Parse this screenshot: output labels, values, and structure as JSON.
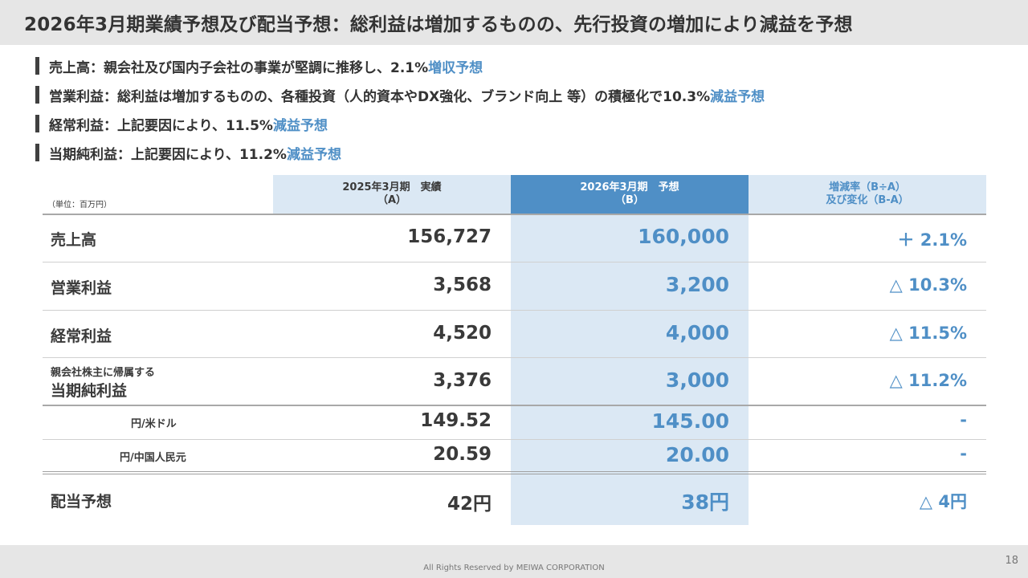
{
  "slide_title": "2026年3月期業績予想及び配当予想：総利益は増加するものの、先行投資の増加により減益を予想",
  "bullets": [
    {
      "text": "売上高：親会社及び国内子会社の事業が堅調に推移し、2.1%",
      "highlight": "増収予想"
    },
    {
      "text": "営業利益：総利益は増加するものの、各種投資（人的資本やDX強化、ブランド向上 等）の積極化で10.3%",
      "highlight": "減益予想"
    },
    {
      "text": "経常利益：上記要因により、11.5%",
      "highlight": "減益予想"
    },
    {
      "text": "当期純利益：上記要因により、11.2%",
      "highlight": "減益予想"
    }
  ],
  "table": {
    "unit": "（単位：百万円）",
    "headers": {
      "a_line1": "2025年3月期　実績",
      "a_line2": "（A）",
      "b_line1": "2026年3月期　予想",
      "b_line2": "（B）",
      "c_line1": "増減率（B÷A）",
      "c_line2": "及び変化（B-A）"
    },
    "rows": [
      {
        "label": "売上高",
        "a": "156,727",
        "b": "160,000",
        "c": "＋ 2.1%"
      },
      {
        "label": "営業利益",
        "a": "3,568",
        "b": "3,200",
        "c": "△ 10.3%"
      },
      {
        "label": "経常利益",
        "a": "4,520",
        "b": "4,000",
        "c": "△ 11.5%"
      },
      {
        "label_line1": "親会社株主に帰属する",
        "label_line2": "当期純利益",
        "a": "3,376",
        "b": "3,000",
        "c": "△ 11.2%"
      },
      {
        "label": "円/米ドル",
        "a": "149.52",
        "b": "145.00",
        "c": "-"
      },
      {
        "label": "円/中国人民元",
        "a": "20.59",
        "b": "20.00",
        "c": "-"
      },
      {
        "label": "配当予想",
        "a": "42円",
        "b": "38円",
        "c": "△ 4円"
      }
    ]
  },
  "footer": "All Rights Reserved by MEIWA CORPORATION",
  "page_number": "18",
  "colors": {
    "accent": "#4f8fc6",
    "light_accent": "#dbe8f4",
    "band": "#e6e6e6"
  }
}
